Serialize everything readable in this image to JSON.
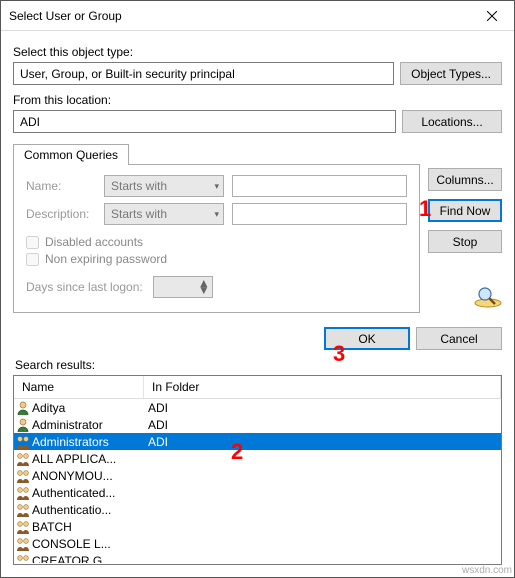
{
  "window": {
    "title": "Select User or Group"
  },
  "labels": {
    "objectType": "Select this object type:",
    "fromLocation": "From this location:",
    "tab": "Common Queries",
    "name": "Name:",
    "description": "Description:",
    "disabledAccounts": "Disabled accounts",
    "nonExpiring": "Non expiring password",
    "daysSince": "Days since last logon:",
    "searchResults": "Search results:",
    "colName": "Name",
    "colFolder": "In Folder"
  },
  "fields": {
    "objectType": "User, Group, or Built-in security principal",
    "location": "ADI",
    "nameMatch": "Starts with",
    "descMatch": "Starts with"
  },
  "buttons": {
    "objectTypes": "Object Types...",
    "locations": "Locations...",
    "columns": "Columns...",
    "findNow": "Find Now",
    "stop": "Stop",
    "ok": "OK",
    "cancel": "Cancel"
  },
  "results": [
    {
      "name": "Aditya",
      "folder": "ADI",
      "type": "user"
    },
    {
      "name": "Administrator",
      "folder": "ADI",
      "type": "user"
    },
    {
      "name": "Administrators",
      "folder": "ADI",
      "type": "group",
      "selected": true
    },
    {
      "name": "ALL APPLICA...",
      "folder": "",
      "type": "group"
    },
    {
      "name": "ANONYMOU...",
      "folder": "",
      "type": "group"
    },
    {
      "name": "Authenticated...",
      "folder": "",
      "type": "group"
    },
    {
      "name": "Authenticatio...",
      "folder": "",
      "type": "group"
    },
    {
      "name": "BATCH",
      "folder": "",
      "type": "group"
    },
    {
      "name": "CONSOLE L...",
      "folder": "",
      "type": "group"
    },
    {
      "name": "CREATOR G...",
      "folder": "",
      "type": "group"
    }
  ],
  "annotations": {
    "a1": "1",
    "a2": "2",
    "a3": "3"
  },
  "watermark": "wsxdn.com"
}
